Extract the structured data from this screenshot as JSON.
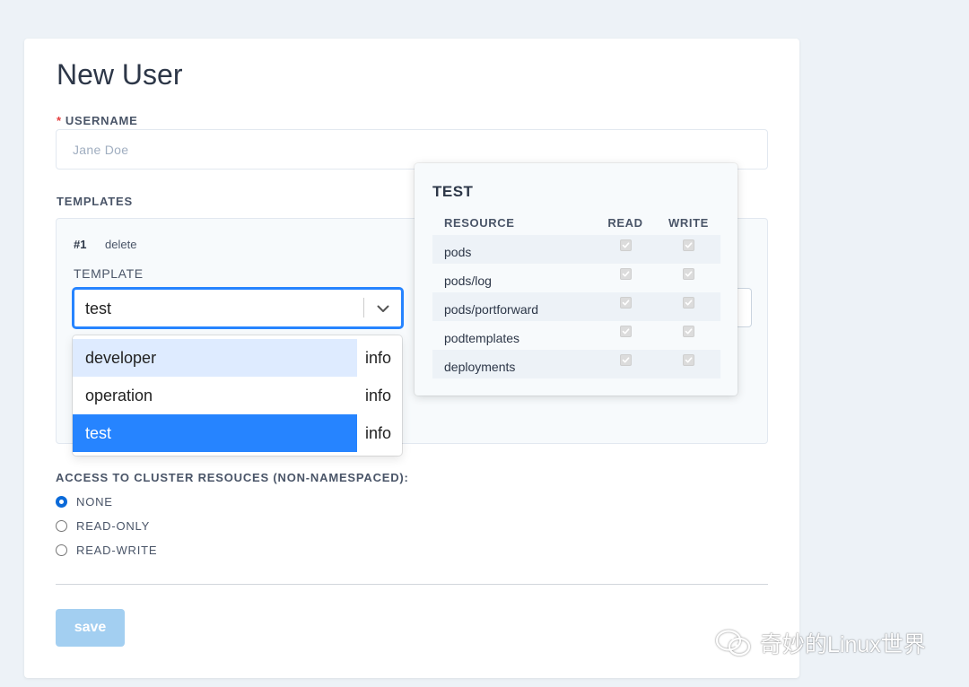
{
  "page": {
    "title": "New User"
  },
  "username": {
    "required_mark": "*",
    "label": "USERNAME",
    "placeholder": "Jane Doe",
    "value": ""
  },
  "templates": {
    "label": "TEMPLATES",
    "items": [
      {
        "index": "#1",
        "delete_label": "delete",
        "template_label": "TEMPLATE",
        "selected": "test"
      }
    ]
  },
  "dropdown": {
    "options": [
      {
        "name": "developer",
        "info": "info",
        "state": "focused"
      },
      {
        "name": "operation",
        "info": "info",
        "state": "normal"
      },
      {
        "name": "test",
        "info": "info",
        "state": "selected"
      }
    ]
  },
  "popover": {
    "title": "TEST",
    "columns": [
      "RESOURCE",
      "READ",
      "WRITE"
    ],
    "rows": [
      {
        "resource": "pods",
        "read": true,
        "write": true
      },
      {
        "resource": "pods/log",
        "read": true,
        "write": true
      },
      {
        "resource": "pods/portforward",
        "read": true,
        "write": true
      },
      {
        "resource": "podtemplates",
        "read": true,
        "write": true
      },
      {
        "resource": "deployments",
        "read": true,
        "write": true
      }
    ]
  },
  "cluster_access": {
    "label": "ACCESS TO CLUSTER RESOUCES (NON-NAMESPACED):",
    "options": [
      {
        "label": "NONE",
        "checked": true
      },
      {
        "label": "READ-ONLY",
        "checked": false
      },
      {
        "label": "READ-WRITE",
        "checked": false
      }
    ]
  },
  "actions": {
    "save_label": "save"
  },
  "watermark": {
    "text": "奇妙的Linux世界"
  },
  "colors": {
    "accent": "#2684ff",
    "focus_option": "#deebff",
    "save_disabled": "#a3cff1",
    "radio_checked": "#0b6ad9",
    "required": "#e53e3e"
  }
}
